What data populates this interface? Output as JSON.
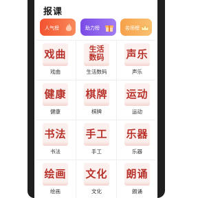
{
  "page": {
    "title": "报课"
  },
  "rankings": [
    {
      "label": "人气榜",
      "color": "#f3522f",
      "icon": "fire-icon"
    },
    {
      "label": "助力榜",
      "color": "#7a4be6",
      "icon": "gift-icon"
    },
    {
      "label": "名师榜",
      "color": "#f7a04a",
      "icon": "crown-icon"
    }
  ],
  "categories": [
    {
      "tile": "戏曲",
      "label": "戏曲"
    },
    {
      "tile": "生活\n数码",
      "label": "生活数码"
    },
    {
      "tile": "声乐",
      "label": "声乐"
    },
    {
      "tile": "健康",
      "label": "健康"
    },
    {
      "tile": "棋牌",
      "label": "棋牌"
    },
    {
      "tile": "运动",
      "label": "运动"
    },
    {
      "tile": "书法",
      "label": "书法"
    },
    {
      "tile": "手工",
      "label": "手工"
    },
    {
      "tile": "乐器",
      "label": "乐器"
    },
    {
      "tile": "绘画",
      "label": "绘画"
    },
    {
      "tile": "文化",
      "label": "文化"
    },
    {
      "tile": "朗诵",
      "label": "朗诵"
    }
  ]
}
